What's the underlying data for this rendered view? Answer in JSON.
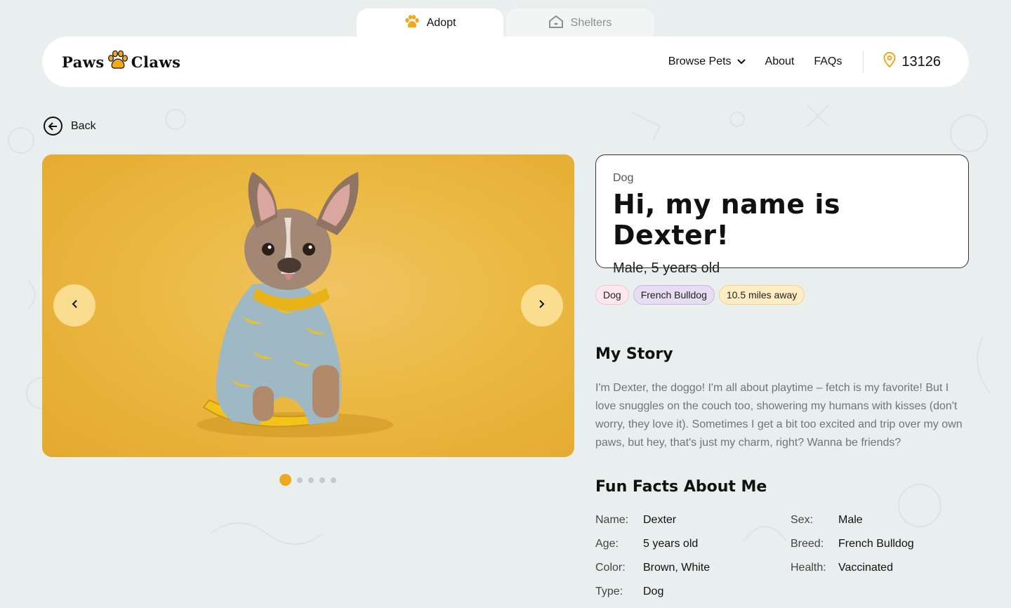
{
  "top_tabs": [
    {
      "label": "Adopt",
      "icon": "paw-icon",
      "active": true
    },
    {
      "label": "Shelters",
      "icon": "house-icon",
      "active": false
    }
  ],
  "header": {
    "logo_left": "Paws",
    "logo_right": "Claws",
    "nav": {
      "browse_pets": "Browse Pets",
      "about": "About",
      "faqs": "FAQs"
    },
    "zip": "13126"
  },
  "back_label": "Back",
  "gallery": {
    "slide_count": 5,
    "active_index": 0
  },
  "pet": {
    "species": "Dog",
    "title": "Hi, my name is Dexter!",
    "subtitle": "Male, 5 years old",
    "tags": [
      "Dog",
      "French Bulldog",
      "10.5 miles away"
    ]
  },
  "story": {
    "title": "My Story",
    "text": "I'm Dexter, the doggo!  I'm all about playtime – fetch is my favorite! But I love snuggles on the couch too, showering my humans with kisses (don't worry, they love it). Sometimes I get a bit too excited and trip over my own paws, but hey, that's just my charm, right? Wanna be friends?"
  },
  "facts": {
    "title": "Fun Facts About Me",
    "left": [
      {
        "label": "Name:",
        "value": "Dexter"
      },
      {
        "label": "Age:",
        "value": "5 years old"
      },
      {
        "label": "Color:",
        "value": "Brown, White"
      },
      {
        "label": "Type:",
        "value": "Dog"
      }
    ],
    "right": [
      {
        "label": "Sex:",
        "value": "Male"
      },
      {
        "label": "Breed:",
        "value": "French Bulldog"
      },
      {
        "label": "Health:",
        "value": "Vaccinated"
      }
    ]
  },
  "colors": {
    "accent": "#f0a81c",
    "background": "#e9eeee"
  }
}
